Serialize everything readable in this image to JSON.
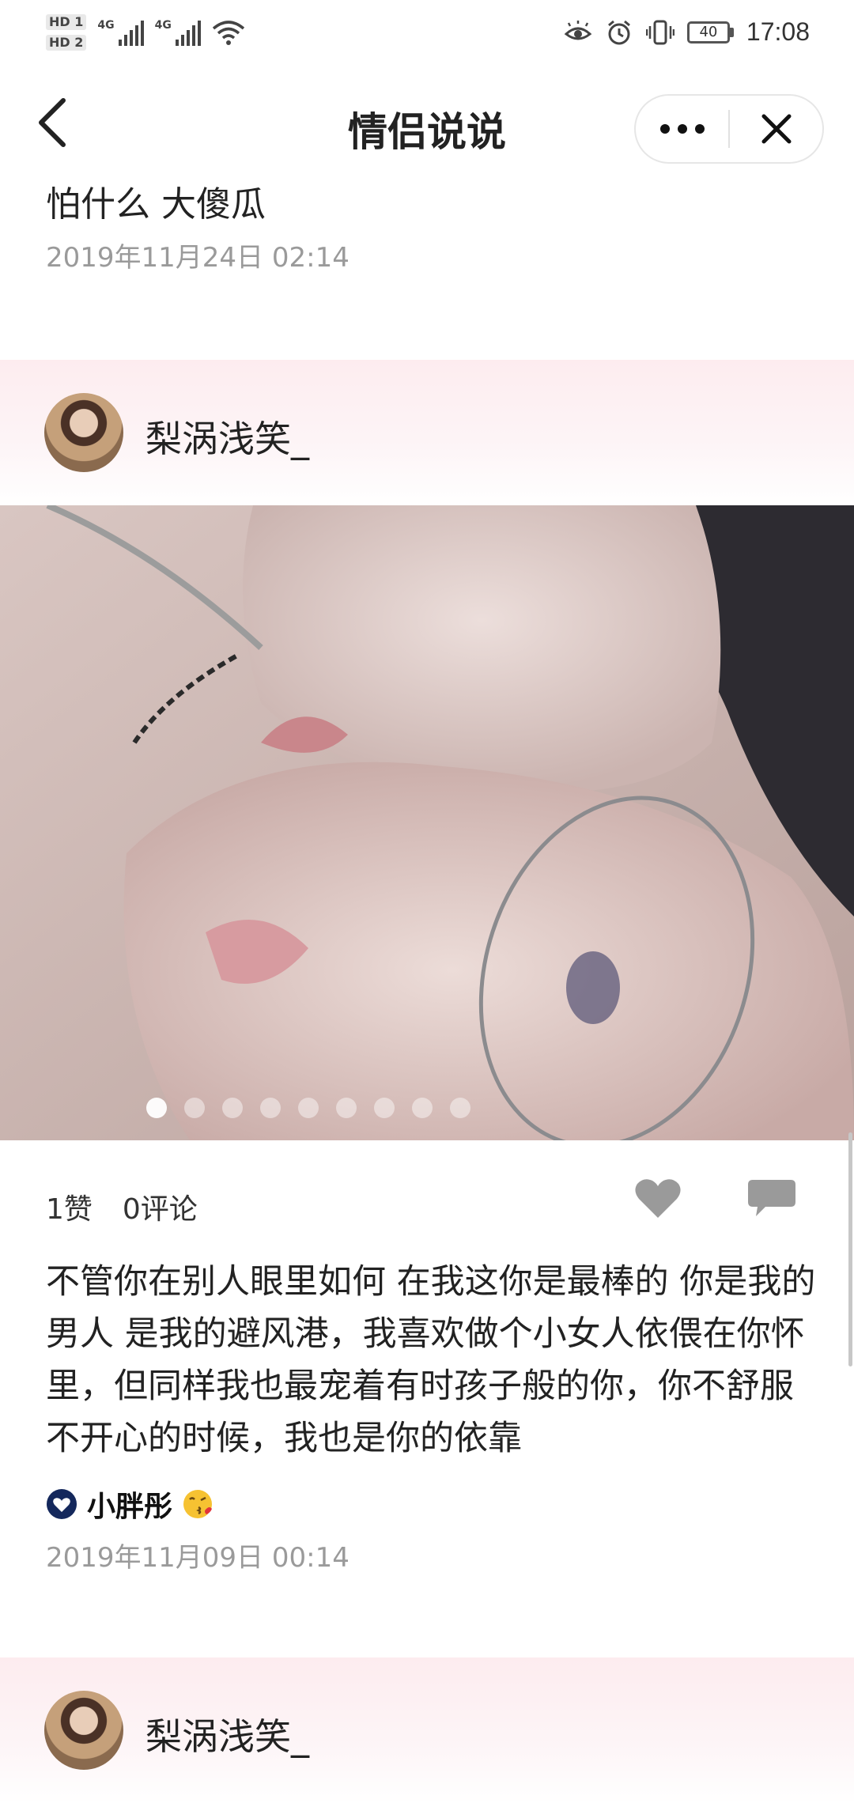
{
  "status_bar": {
    "sim1": "HD 1",
    "sim2": "HD 2",
    "net1": "4G",
    "net2": "4G",
    "battery": "40",
    "time": "17:08",
    "icons": [
      "eye-comfort-icon",
      "alarm-icon",
      "vibrate-icon",
      "wifi-icon",
      "battery-icon"
    ]
  },
  "nav": {
    "title": "情侣说说",
    "back_icon": "chevron-left-icon",
    "more_icon": "more-dots-icon",
    "close_icon": "close-icon"
  },
  "prev_post": {
    "text": "怕什么 大傻瓜",
    "date": "2019年11月24日 02:14"
  },
  "post": {
    "author": "梨涡浅笑_",
    "photo_count": 9,
    "active_photo": 1,
    "likes": "1赞",
    "comments": "0评论",
    "text": "不管你在别人眼里如何 在我这你是最棒的 你是我的男人 是我的避风港，我喜欢做个小女人依偎在你怀里，但同样我也最宠着有时孩子般的你，你不舒服不开心的时候，我也是你的依靠",
    "liked_by": "小胖彤",
    "liked_by_emoji": "kiss-emoji",
    "date": "2019年11月09日 00:14"
  },
  "next_post": {
    "author": "梨涡浅笑_"
  },
  "colors": {
    "accent_navy": "#14285c",
    "band_pink": "#fdecef",
    "meta_gray": "#9a9a9a"
  }
}
